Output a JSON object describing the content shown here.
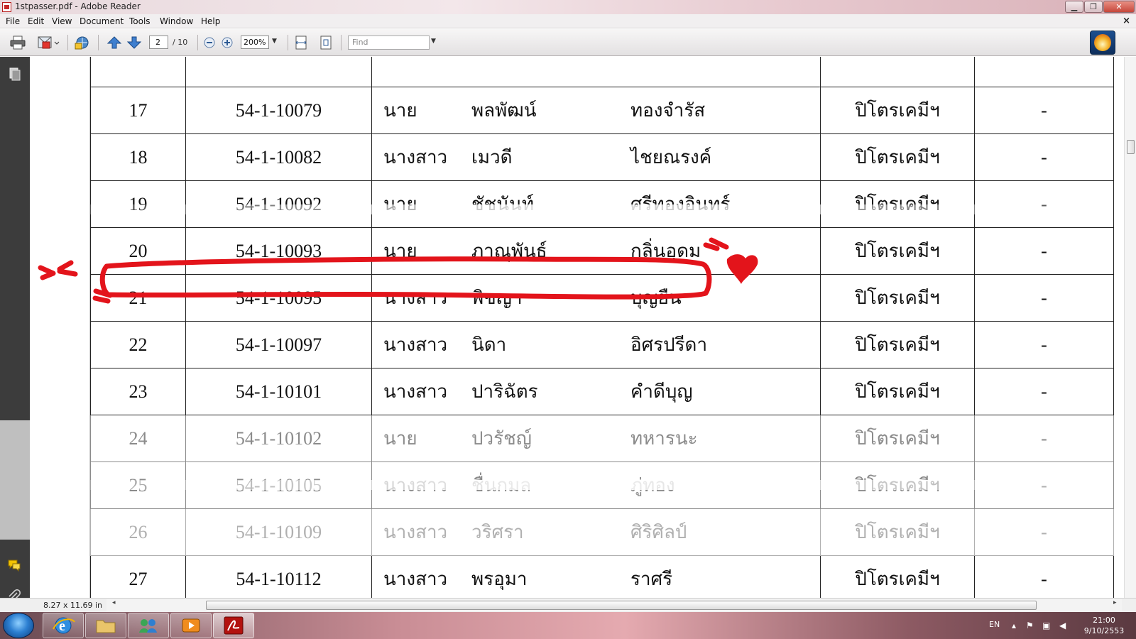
{
  "window": {
    "title": "1stpasser.pdf - Adobe Reader",
    "minimize": "▁",
    "maximize": "❐",
    "close": "✕"
  },
  "menu": {
    "items": [
      "File",
      "Edit",
      "View",
      "Document",
      "Tools",
      "Window",
      "Help"
    ],
    "close_doc": "×"
  },
  "toolbar": {
    "page_current": "2",
    "page_total": "/ 10",
    "zoom": "200%",
    "find_placeholder": "Find"
  },
  "table": {
    "rows": [
      {
        "no": "17",
        "id": "54-1-10079",
        "prefix": "นาย",
        "first": "พลพัฒน์",
        "last": "ทองจำรัส",
        "program": "ปิโตรเคมีฯ",
        "note": "-"
      },
      {
        "no": "18",
        "id": "54-1-10082",
        "prefix": "นางสาว",
        "first": "เมวดี",
        "last": "ไชยณรงค์",
        "program": "ปิโตรเคมีฯ",
        "note": "-"
      },
      {
        "no": "19",
        "id": "54-1-10092",
        "prefix": "นาย",
        "first": "ชัชนันท์",
        "last": "ศรีทองอินทร์",
        "program": "ปิโตรเคมีฯ",
        "note": "-"
      },
      {
        "no": "20",
        "id": "54-1-10093",
        "prefix": "นาย",
        "first": "ภาณุพันธ์",
        "last": "กลิ่นอุดม",
        "program": "ปิโตรเคมีฯ",
        "note": "-"
      },
      {
        "no": "21",
        "id": "54-1-10095",
        "prefix": "นางสาว",
        "first": "พิชญา",
        "last": "บุญยืน",
        "program": "ปิโตรเคมีฯ",
        "note": "-"
      },
      {
        "no": "22",
        "id": "54-1-10097",
        "prefix": "นางสาว",
        "first": "นิดา",
        "last": "อิศรปรีดา",
        "program": "ปิโตรเคมีฯ",
        "note": "-"
      },
      {
        "no": "23",
        "id": "54-1-10101",
        "prefix": "นางสาว",
        "first": "ปาริฉัตร",
        "last": "คำดีบุญ",
        "program": "ปิโตรเคมีฯ",
        "note": "-"
      },
      {
        "no": "24",
        "id": "54-1-10102",
        "prefix": "นาย",
        "first": "ปวรัชญ์",
        "last": "ทหารนะ",
        "program": "ปิโตรเคมีฯ",
        "note": "-"
      },
      {
        "no": "25",
        "id": "54-1-10105",
        "prefix": "นางสาว",
        "first": "ชื่นกมล",
        "last": "ภู่ทอง",
        "program": "ปิโตรเคมีฯ",
        "note": "-"
      },
      {
        "no": "26",
        "id": "54-1-10109",
        "prefix": "นางสาว",
        "first": "วริศรา",
        "last": "ศิริศิลป์",
        "program": "ปิโตรเคมีฯ",
        "note": "-"
      },
      {
        "no": "27",
        "id": "54-1-10112",
        "prefix": "นางสาว",
        "first": "พรอุมา",
        "last": "ราศรี",
        "program": "ปิโตรเคมีฯ",
        "note": "-"
      }
    ]
  },
  "status": {
    "page_size": "8.27 x 11.69 in"
  },
  "taskbar": {
    "language": "EN",
    "time": "21:00",
    "date": "9/10/2553"
  },
  "colors": {
    "annotation": "#e3141b",
    "nav_panel": "#3c3c3c"
  }
}
